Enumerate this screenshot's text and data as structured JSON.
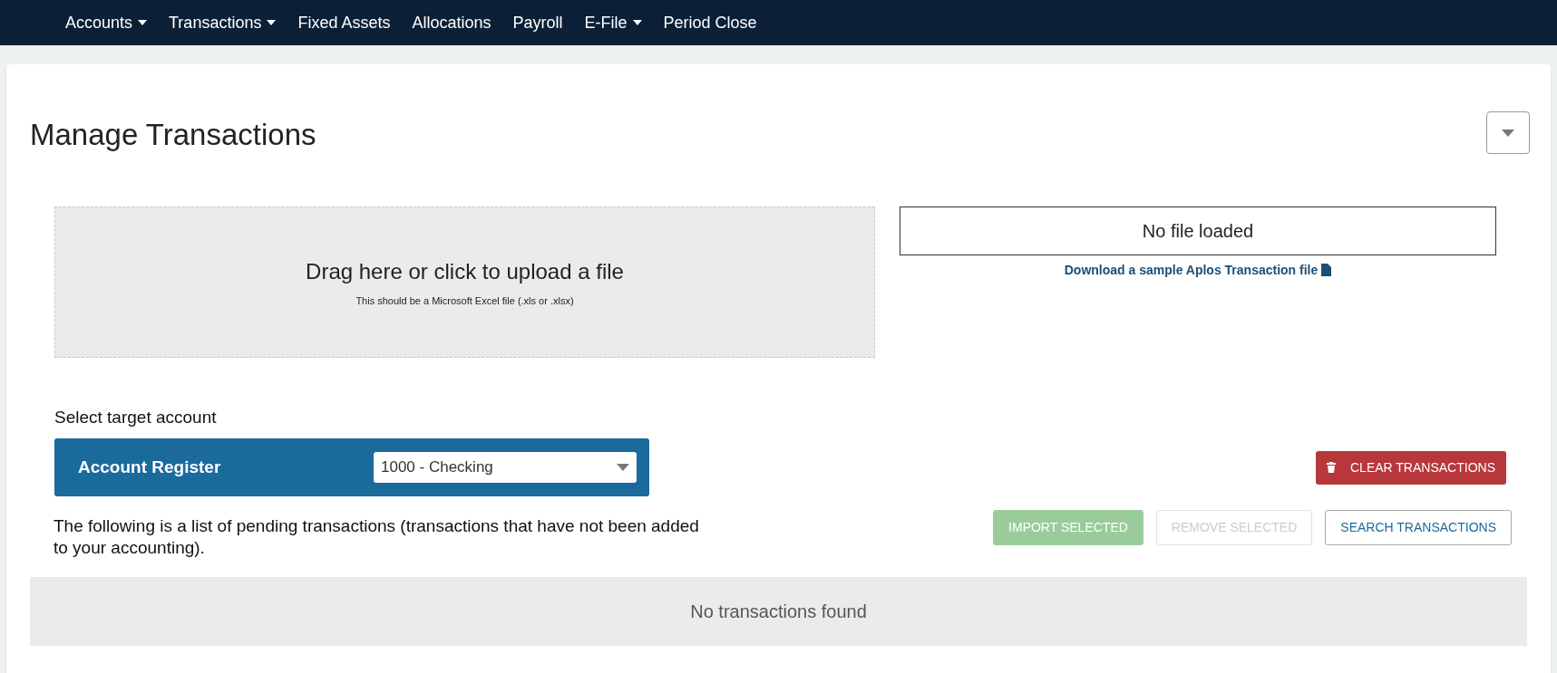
{
  "nav": [
    {
      "label": "Accounts",
      "dropdown": true
    },
    {
      "label": "Transactions",
      "dropdown": true
    },
    {
      "label": "Fixed Assets",
      "dropdown": false
    },
    {
      "label": "Allocations",
      "dropdown": false
    },
    {
      "label": "Payroll",
      "dropdown": false
    },
    {
      "label": "E-File",
      "dropdown": true
    },
    {
      "label": "Period Close",
      "dropdown": false
    }
  ],
  "page": {
    "title": "Manage Transactions"
  },
  "upload": {
    "heading": "Drag here or click to upload a file",
    "hint": "This should be a Microsoft Excel file (.xls or .xlsx)"
  },
  "file_status": "No file loaded",
  "sample_link": "Download a sample Aplos Transaction file",
  "target": {
    "label": "Select target account",
    "register_label": "Account Register",
    "account": "1000 - Checking"
  },
  "clear_button": "CLEAR TRANSACTIONS",
  "description": "The following is a list of pending transactions (transactions that have not been added to your accounting).",
  "actions": [
    {
      "label": "IMPORT SELECTED",
      "kind": "success",
      "disabled": true
    },
    {
      "label": "REMOVE SELECTED",
      "kind": "outline",
      "disabled": true
    },
    {
      "label": "SEARCH TRANSACTIONS",
      "kind": "outline",
      "disabled": false
    }
  ],
  "empty_message": "No transactions found"
}
